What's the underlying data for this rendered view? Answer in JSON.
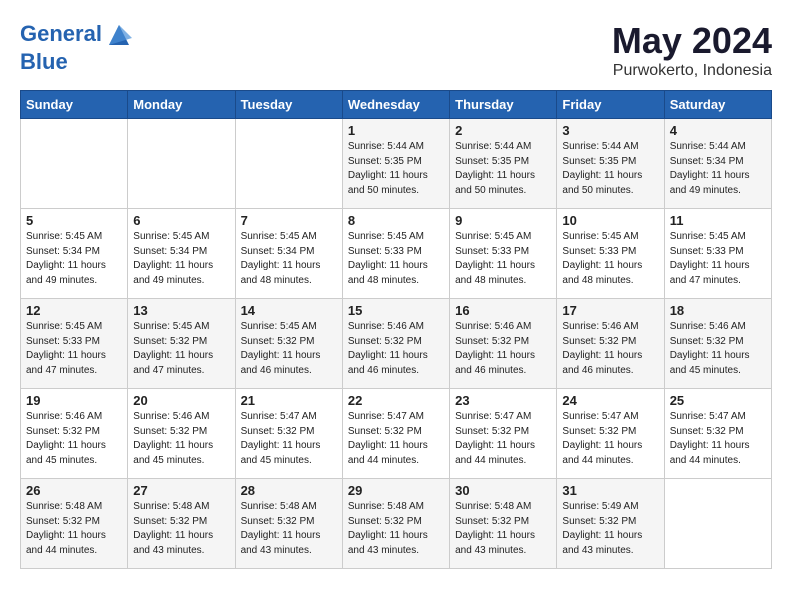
{
  "header": {
    "logo_line1": "General",
    "logo_line2": "Blue",
    "month_title": "May 2024",
    "location": "Purwokerto, Indonesia"
  },
  "days_of_week": [
    "Sunday",
    "Monday",
    "Tuesday",
    "Wednesday",
    "Thursday",
    "Friday",
    "Saturday"
  ],
  "weeks": [
    [
      {
        "day": "",
        "info": ""
      },
      {
        "day": "",
        "info": ""
      },
      {
        "day": "",
        "info": ""
      },
      {
        "day": "1",
        "info": "Sunrise: 5:44 AM\nSunset: 5:35 PM\nDaylight: 11 hours\nand 50 minutes."
      },
      {
        "day": "2",
        "info": "Sunrise: 5:44 AM\nSunset: 5:35 PM\nDaylight: 11 hours\nand 50 minutes."
      },
      {
        "day": "3",
        "info": "Sunrise: 5:44 AM\nSunset: 5:35 PM\nDaylight: 11 hours\nand 50 minutes."
      },
      {
        "day": "4",
        "info": "Sunrise: 5:44 AM\nSunset: 5:34 PM\nDaylight: 11 hours\nand 49 minutes."
      }
    ],
    [
      {
        "day": "5",
        "info": "Sunrise: 5:45 AM\nSunset: 5:34 PM\nDaylight: 11 hours\nand 49 minutes."
      },
      {
        "day": "6",
        "info": "Sunrise: 5:45 AM\nSunset: 5:34 PM\nDaylight: 11 hours\nand 49 minutes."
      },
      {
        "day": "7",
        "info": "Sunrise: 5:45 AM\nSunset: 5:34 PM\nDaylight: 11 hours\nand 48 minutes."
      },
      {
        "day": "8",
        "info": "Sunrise: 5:45 AM\nSunset: 5:33 PM\nDaylight: 11 hours\nand 48 minutes."
      },
      {
        "day": "9",
        "info": "Sunrise: 5:45 AM\nSunset: 5:33 PM\nDaylight: 11 hours\nand 48 minutes."
      },
      {
        "day": "10",
        "info": "Sunrise: 5:45 AM\nSunset: 5:33 PM\nDaylight: 11 hours\nand 48 minutes."
      },
      {
        "day": "11",
        "info": "Sunrise: 5:45 AM\nSunset: 5:33 PM\nDaylight: 11 hours\nand 47 minutes."
      }
    ],
    [
      {
        "day": "12",
        "info": "Sunrise: 5:45 AM\nSunset: 5:33 PM\nDaylight: 11 hours\nand 47 minutes."
      },
      {
        "day": "13",
        "info": "Sunrise: 5:45 AM\nSunset: 5:32 PM\nDaylight: 11 hours\nand 47 minutes."
      },
      {
        "day": "14",
        "info": "Sunrise: 5:45 AM\nSunset: 5:32 PM\nDaylight: 11 hours\nand 46 minutes."
      },
      {
        "day": "15",
        "info": "Sunrise: 5:46 AM\nSunset: 5:32 PM\nDaylight: 11 hours\nand 46 minutes."
      },
      {
        "day": "16",
        "info": "Sunrise: 5:46 AM\nSunset: 5:32 PM\nDaylight: 11 hours\nand 46 minutes."
      },
      {
        "day": "17",
        "info": "Sunrise: 5:46 AM\nSunset: 5:32 PM\nDaylight: 11 hours\nand 46 minutes."
      },
      {
        "day": "18",
        "info": "Sunrise: 5:46 AM\nSunset: 5:32 PM\nDaylight: 11 hours\nand 45 minutes."
      }
    ],
    [
      {
        "day": "19",
        "info": "Sunrise: 5:46 AM\nSunset: 5:32 PM\nDaylight: 11 hours\nand 45 minutes."
      },
      {
        "day": "20",
        "info": "Sunrise: 5:46 AM\nSunset: 5:32 PM\nDaylight: 11 hours\nand 45 minutes."
      },
      {
        "day": "21",
        "info": "Sunrise: 5:47 AM\nSunset: 5:32 PM\nDaylight: 11 hours\nand 45 minutes."
      },
      {
        "day": "22",
        "info": "Sunrise: 5:47 AM\nSunset: 5:32 PM\nDaylight: 11 hours\nand 44 minutes."
      },
      {
        "day": "23",
        "info": "Sunrise: 5:47 AM\nSunset: 5:32 PM\nDaylight: 11 hours\nand 44 minutes."
      },
      {
        "day": "24",
        "info": "Sunrise: 5:47 AM\nSunset: 5:32 PM\nDaylight: 11 hours\nand 44 minutes."
      },
      {
        "day": "25",
        "info": "Sunrise: 5:47 AM\nSunset: 5:32 PM\nDaylight: 11 hours\nand 44 minutes."
      }
    ],
    [
      {
        "day": "26",
        "info": "Sunrise: 5:48 AM\nSunset: 5:32 PM\nDaylight: 11 hours\nand 44 minutes."
      },
      {
        "day": "27",
        "info": "Sunrise: 5:48 AM\nSunset: 5:32 PM\nDaylight: 11 hours\nand 43 minutes."
      },
      {
        "day": "28",
        "info": "Sunrise: 5:48 AM\nSunset: 5:32 PM\nDaylight: 11 hours\nand 43 minutes."
      },
      {
        "day": "29",
        "info": "Sunrise: 5:48 AM\nSunset: 5:32 PM\nDaylight: 11 hours\nand 43 minutes."
      },
      {
        "day": "30",
        "info": "Sunrise: 5:48 AM\nSunset: 5:32 PM\nDaylight: 11 hours\nand 43 minutes."
      },
      {
        "day": "31",
        "info": "Sunrise: 5:49 AM\nSunset: 5:32 PM\nDaylight: 11 hours\nand 43 minutes."
      },
      {
        "day": "",
        "info": ""
      }
    ]
  ]
}
